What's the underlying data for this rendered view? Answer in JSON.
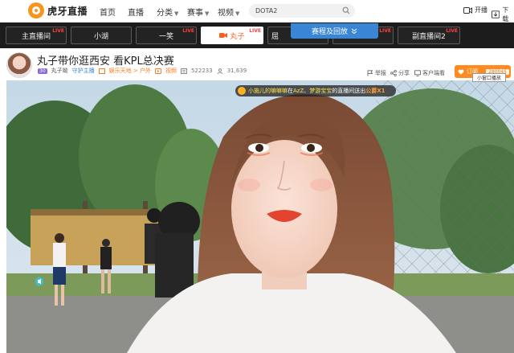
{
  "brand": {
    "logo_text": "虎牙直播"
  },
  "nav": {
    "home": "首页",
    "live": "直播",
    "category": "分类",
    "events": "赛事",
    "video": "视频"
  },
  "search": {
    "value": "DOTA2"
  },
  "top_right": {
    "broadcast": "开播",
    "download": "下载"
  },
  "channels": [
    {
      "label": "主直播间",
      "badge": "LIVE"
    },
    {
      "label": "小湖",
      "badge": ""
    },
    {
      "label": "一笑",
      "badge": "LIVE"
    },
    {
      "label": "丸子",
      "badge": "LIVE"
    },
    {
      "label": "屈",
      "badge": ""
    },
    {
      "label": "",
      "badge": "LIVE"
    },
    {
      "label": "副直播间2",
      "badge": "LIVE"
    }
  ],
  "schedule_button": "赛程及回放",
  "room": {
    "title": "丸子带你逛西安 看KPL总决赛",
    "level": "30",
    "streamer_name": "丸子呦",
    "guard_label": "守护主播",
    "category": "娱乐天地",
    "subcategory": "户外",
    "video_label": "视频",
    "view_count": "522233",
    "fans_count": "31,639"
  },
  "actions": {
    "report": "举报",
    "share": "分享",
    "client": "客户端看"
  },
  "subscribe": {
    "label": "订阅",
    "count": "280045"
  },
  "mini_window": "小窗口播放",
  "gift_banner": {
    "user": "小施儿的嘛嘛嘛",
    "in_text": " 在 ",
    "source": "AzZ、梦游宝宝",
    "middle": " 的直播间送出 ",
    "gift": "公爵X1"
  },
  "colors": {
    "accent_orange": "#ff8a1f",
    "channel_bg": "#1c1c1c",
    "schedule_blue": "#3a86d4",
    "live_red": "#ff4040"
  }
}
